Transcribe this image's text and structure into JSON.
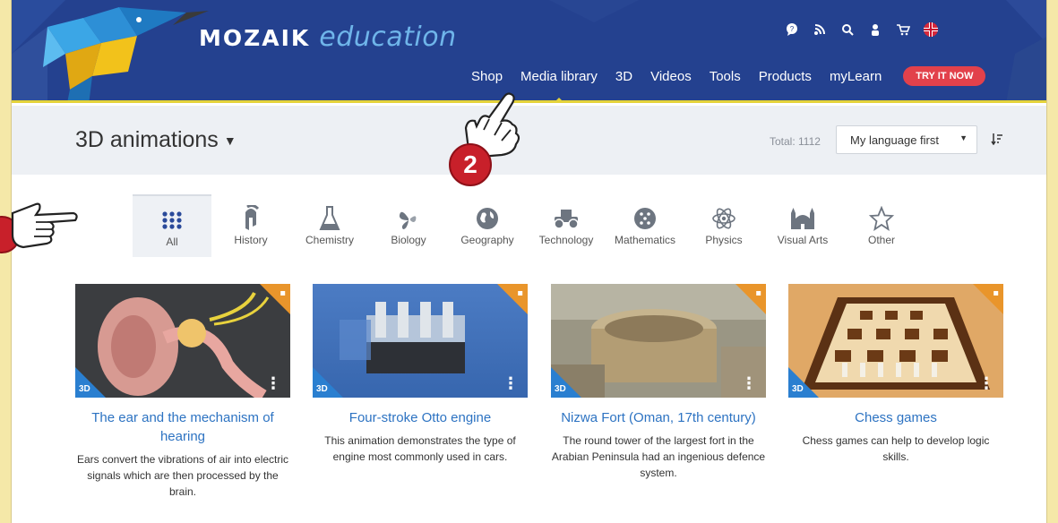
{
  "brand": {
    "word": "MOZAIK",
    "edu": "education"
  },
  "top_icons": [
    "chat-icon",
    "rss-icon",
    "search-icon",
    "user-icon",
    "cart-icon",
    "flag-uk-icon"
  ],
  "nav": {
    "items": [
      "Shop",
      "Media library",
      "3D",
      "Videos",
      "Tools",
      "Products",
      "myLearn"
    ],
    "try_now": "TRY IT NOW"
  },
  "subbar": {
    "title": "3D animations",
    "total": "Total: 1112",
    "language_select": "My language first"
  },
  "categories": [
    {
      "label": "All",
      "icon": "grid-icon"
    },
    {
      "label": "History",
      "icon": "helmet-icon"
    },
    {
      "label": "Chemistry",
      "icon": "flask-icon"
    },
    {
      "label": "Biology",
      "icon": "butterfly-icon"
    },
    {
      "label": "Geography",
      "icon": "globe-icon"
    },
    {
      "label": "Technology",
      "icon": "car-icon"
    },
    {
      "label": "Mathematics",
      "icon": "dice-icon"
    },
    {
      "label": "Physics",
      "icon": "atom-icon"
    },
    {
      "label": "Visual Arts",
      "icon": "building-icon"
    },
    {
      "label": "Other",
      "icon": "star-icon"
    }
  ],
  "cards": [
    {
      "title": "The ear and the mechanism of hearing",
      "description": "Ears convert the vibrations of air into electric signals which are then processed by the brain.",
      "badge": "3D"
    },
    {
      "title": "Four-stroke Otto engine",
      "description": "This animation demonstrates the type of engine most commonly used in cars.",
      "badge": "3D"
    },
    {
      "title": "Nizwa Fort (Oman, 17th century)",
      "description": "The round tower of the largest fort in the Arabian Peninsula had an ingenious defence system.",
      "badge": "3D"
    },
    {
      "title": "Chess games",
      "description": "Chess games can help to develop logic skills.",
      "badge": "3D"
    }
  ],
  "step_marker": "2",
  "colors": {
    "header": "#24418f",
    "accent_yellow": "#e4d33a",
    "try_button": "#e2414b",
    "link_blue": "#2d73c2",
    "badge_blue": "#2a7fd0",
    "badge_orange": "#e9952b"
  }
}
